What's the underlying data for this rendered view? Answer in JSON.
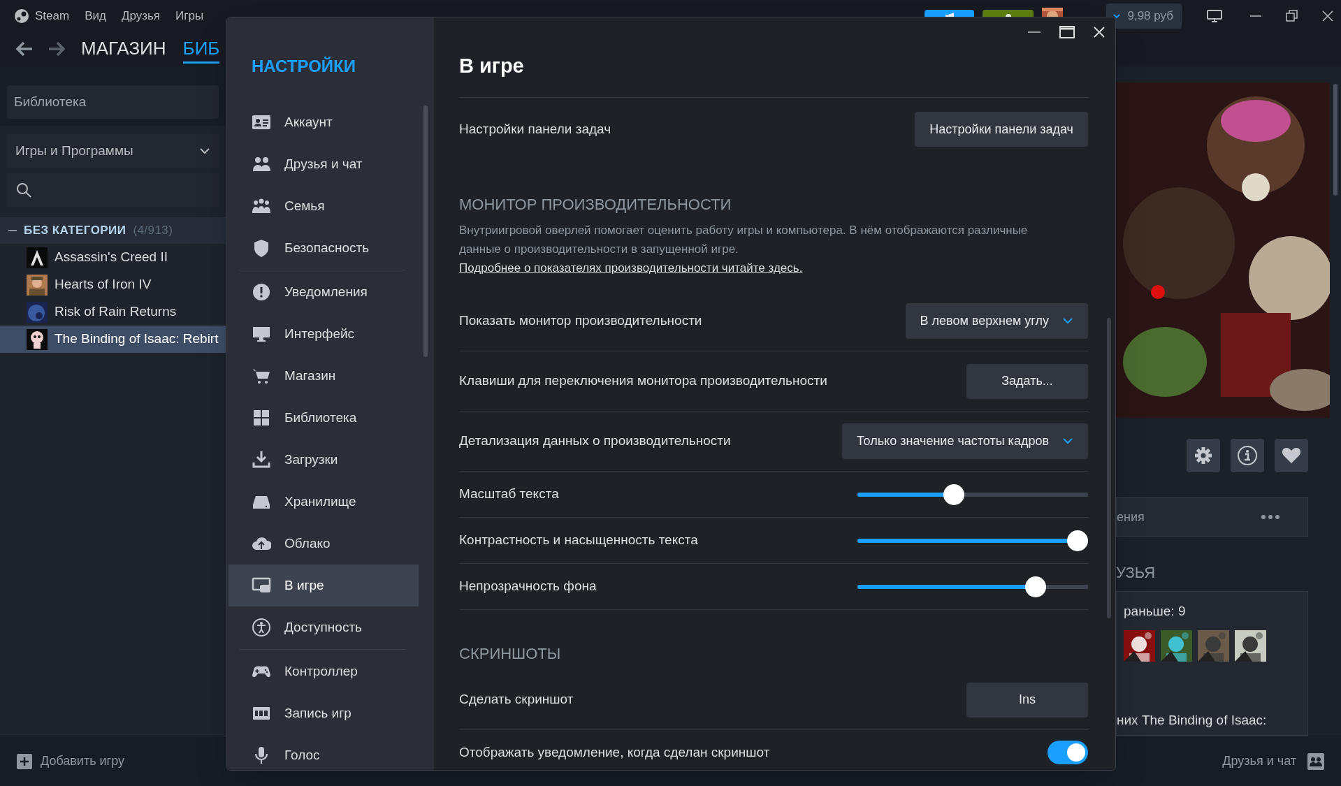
{
  "menu": [
    "Steam",
    "Вид",
    "Друзья",
    "Игры"
  ],
  "header": {
    "balance": "9,98 руб"
  },
  "nav_tabs": [
    {
      "label": "МАГАЗИН",
      "selected": false
    },
    {
      "label": "БИБ",
      "selected": true
    }
  ],
  "library": {
    "title": "Библиотека",
    "filter": "Игры и Программы",
    "category": {
      "name": "БЕЗ КАТЕГОРИИ",
      "count": "(4/913)",
      "expanded": true
    },
    "games": [
      {
        "name": "Assassin's Creed II",
        "selected": false
      },
      {
        "name": "Hearts of Iron IV",
        "selected": false
      },
      {
        "name": "Risk of Rain Returns",
        "selected": false
      },
      {
        "name": "The Binding of Isaac: Rebirt",
        "selected": true
      }
    ]
  },
  "settings": {
    "title": "НАСТРОЙКИ",
    "page_title": "В игре",
    "nav_groups": [
      [
        {
          "label": "Аккаунт",
          "selected": false
        },
        {
          "label": "Друзья и чат",
          "selected": false
        },
        {
          "label": "Семья",
          "selected": false
        },
        {
          "label": "Безопасность",
          "selected": false
        }
      ],
      [
        {
          "label": "Уведомления",
          "selected": false
        },
        {
          "label": "Интерфейс",
          "selected": false
        },
        {
          "label": "Магазин",
          "selected": false
        },
        {
          "label": "Библиотека",
          "selected": false
        },
        {
          "label": "Загрузки",
          "selected": false
        },
        {
          "label": "Хранилище",
          "selected": false
        },
        {
          "label": "Облако",
          "selected": false
        },
        {
          "label": "В игре",
          "selected": true
        },
        {
          "label": "Доступность",
          "selected": false
        }
      ],
      [
        {
          "label": "Контроллер",
          "selected": false
        },
        {
          "label": "Запись игр",
          "selected": false
        },
        {
          "label": "Голос",
          "selected": false
        }
      ]
    ],
    "sections": [
      {
        "rows": [
          {
            "kind": "button",
            "label": "Настройки панели задач",
            "value": "Настройки панели задач"
          }
        ]
      },
      {
        "heading": "МОНИТОР ПРОИЗВОДИТЕЛЬНОСТИ",
        "description": "Внутриигровой оверлей помогает оценить работу игры и компьютера. В нём отображаются различные данные о производительности в запущенной игре.",
        "link": "Подробнее о показателях производительности читайте здесь.",
        "rows": [
          {
            "kind": "dropdown",
            "label": "Показать монитор производительности",
            "value": "В левом верхнем углу"
          },
          {
            "kind": "button",
            "label": "Клавиши для переключения монитора производительности",
            "value": "Задать..."
          },
          {
            "kind": "dropdown",
            "label": "Детализация данных о производительности",
            "value": "Только значение частоты кадров"
          },
          {
            "kind": "slider",
            "label": "Масштаб текста",
            "level": 0.41
          },
          {
            "kind": "slider",
            "label": "Контрастность и насыщенность текста",
            "level": 1
          },
          {
            "kind": "slider",
            "label": "Непрозрачность фона",
            "level": 0.8
          }
        ]
      },
      {
        "heading": "СКРИНШОТЫ",
        "rows": [
          {
            "kind": "button",
            "label": "Сделать скриншот",
            "value": "Ins"
          },
          {
            "kind": "toggle",
            "label": "Отображать уведомление, когда сделан скриншот",
            "on": true
          }
        ]
      }
    ]
  },
  "game_panel": {
    "tab_fragment": "ения",
    "friends_heading": "УЗЬЯ",
    "played_before": "раньше: 9",
    "recent_text": "них The Binding of Isaac:"
  },
  "bottom_bar": {
    "add_game": "Добавить игру",
    "friends_chat": "Друзья и чат"
  }
}
